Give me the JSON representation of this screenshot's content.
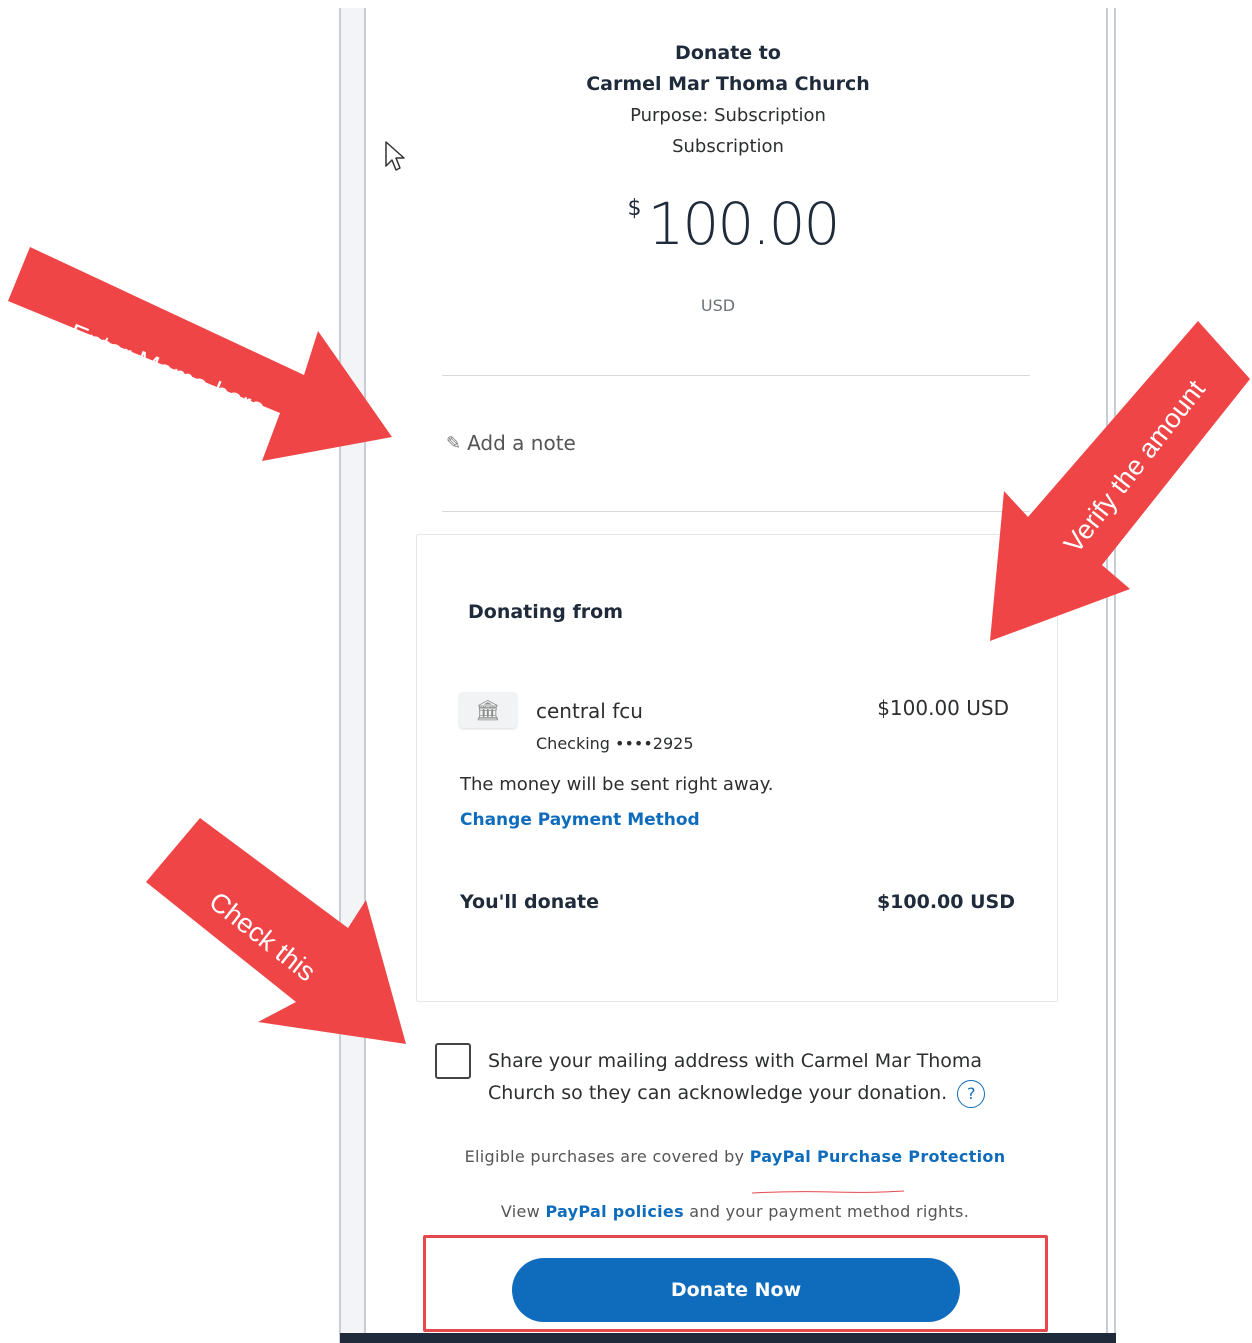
{
  "donation": {
    "title_line1": "Donate to",
    "title_line2": "Carmel Mar Thoma Church",
    "purpose_line1": "Purpose: Subscription",
    "purpose_line2": "Subscription",
    "currency_symbol": "$",
    "amount": "100.00",
    "currency_code": "USD"
  },
  "note": {
    "label": "Add a note"
  },
  "payment": {
    "heading": "Donating from",
    "bank_name": "central fcu",
    "account": "Checking ••••2925",
    "amount": "$100.00 USD",
    "message": "The money will be sent right away.",
    "change_link": "Change Payment Method",
    "total_label": "You'll donate",
    "total_amount": "$100.00 USD"
  },
  "share": {
    "text": "Share your mailing address with Carmel Mar Thoma Church so they can acknowledge your donation.",
    "help": "?"
  },
  "legal": {
    "protection_prefix": "Eligible purchases are covered by",
    "protection_link": "PayPal Purchase Protection",
    "policies_prefix": "View",
    "policies_link": "PayPal policies",
    "policies_suffix": "and your payment method rights."
  },
  "actions": {
    "donate_label": "Donate Now"
  },
  "annotations": {
    "memo": "Enter Memo here",
    "verify": "Verify the amount",
    "check": "Check this"
  },
  "colors": {
    "accent": "#0f6cbd",
    "arrow": "#f04547",
    "highlight_box": "#e5484d"
  }
}
